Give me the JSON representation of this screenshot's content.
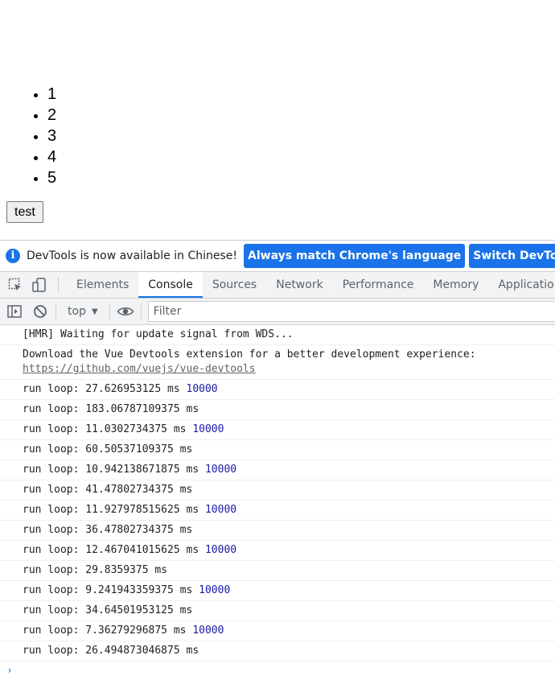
{
  "page": {
    "list_items": [
      "1",
      "2",
      "3",
      "4",
      "5"
    ],
    "test_button_label": "test"
  },
  "devtools": {
    "infobar": {
      "message": "DevTools is now available in Chinese!",
      "button_match_language": "Always match Chrome's language",
      "button_switch": "Switch DevTools to Chinese"
    },
    "tabs": [
      {
        "label": "Elements",
        "active": false
      },
      {
        "label": "Console",
        "active": true
      },
      {
        "label": "Sources",
        "active": false
      },
      {
        "label": "Network",
        "active": false
      },
      {
        "label": "Performance",
        "active": false
      },
      {
        "label": "Memory",
        "active": false
      },
      {
        "label": "Application",
        "active": false
      }
    ],
    "console_toolbar": {
      "context": "top",
      "filter_placeholder": "Filter"
    },
    "colors": {
      "accent": "#1a73e8",
      "number": "#1a1aa6"
    },
    "logs": [
      {
        "text": "[HMR] Waiting for update signal from WDS...",
        "num": ""
      },
      {
        "text": "Download the Vue Devtools extension for a better development experience:",
        "link": "https://github.com/vuejs/vue-devtools",
        "num": ""
      },
      {
        "text": "run loop: 27.626953125 ms",
        "num": "10000"
      },
      {
        "text": "run loop: 183.06787109375 ms",
        "num": ""
      },
      {
        "text": "run loop: 11.0302734375 ms",
        "num": "10000"
      },
      {
        "text": "run loop: 60.50537109375 ms",
        "num": ""
      },
      {
        "text": "run loop: 10.942138671875 ms",
        "num": "10000"
      },
      {
        "text": "run loop: 41.47802734375 ms",
        "num": ""
      },
      {
        "text": "run loop: 11.927978515625 ms",
        "num": "10000"
      },
      {
        "text": "run loop: 36.47802734375 ms",
        "num": ""
      },
      {
        "text": "run loop: 12.467041015625 ms",
        "num": "10000"
      },
      {
        "text": "run loop: 29.8359375 ms",
        "num": ""
      },
      {
        "text": "run loop: 9.241943359375 ms",
        "num": "10000"
      },
      {
        "text": "run loop: 34.64501953125 ms",
        "num": ""
      },
      {
        "text": "run loop: 7.36279296875 ms",
        "num": "10000"
      },
      {
        "text": "run loop: 26.494873046875 ms",
        "num": ""
      }
    ]
  }
}
